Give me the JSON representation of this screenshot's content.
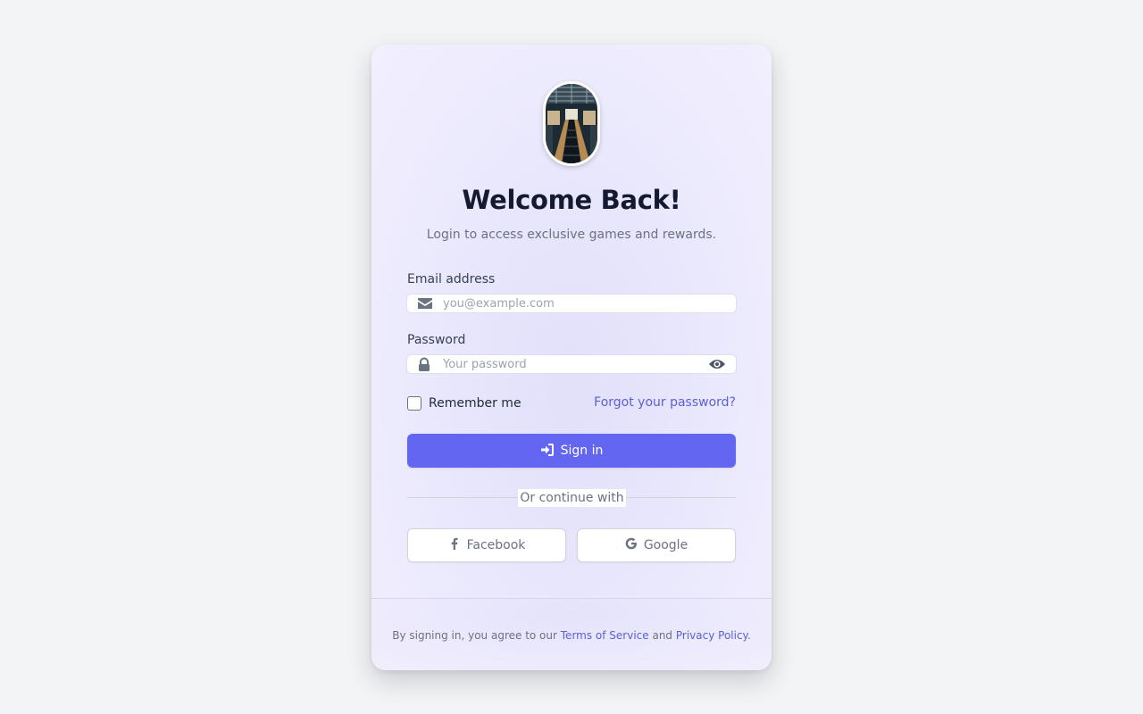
{
  "login": {
    "title": "Welcome Back!",
    "subtitle": "Login to access exclusive games and rewards.",
    "email": {
      "label": "Email address",
      "placeholder": "you@example.com",
      "value": "",
      "icon": "envelope-icon"
    },
    "password": {
      "label": "Password",
      "placeholder": "Your password",
      "value": "",
      "icon": "lock-icon",
      "toggle_icon": "eye-icon"
    },
    "remember_label": "Remember me",
    "remember_checked": false,
    "forgot_label": "Forgot your password?",
    "signin_label": "Sign in",
    "signin_icon": "sign-in-icon",
    "divider_text": "Or continue with",
    "social": [
      {
        "label": "Facebook",
        "icon": "facebook-icon"
      },
      {
        "label": "Google",
        "icon": "google-icon"
      }
    ]
  },
  "footer": {
    "prefix": "By signing in, you agree to our ",
    "terms_label": "Terms of Service",
    "middle": " and ",
    "privacy_label": "Privacy Policy",
    "suffix": "."
  },
  "colors": {
    "accent": "#6366f1",
    "link": "#5b5fd6",
    "background": "#f3f4f6",
    "heading": "#151a33"
  }
}
